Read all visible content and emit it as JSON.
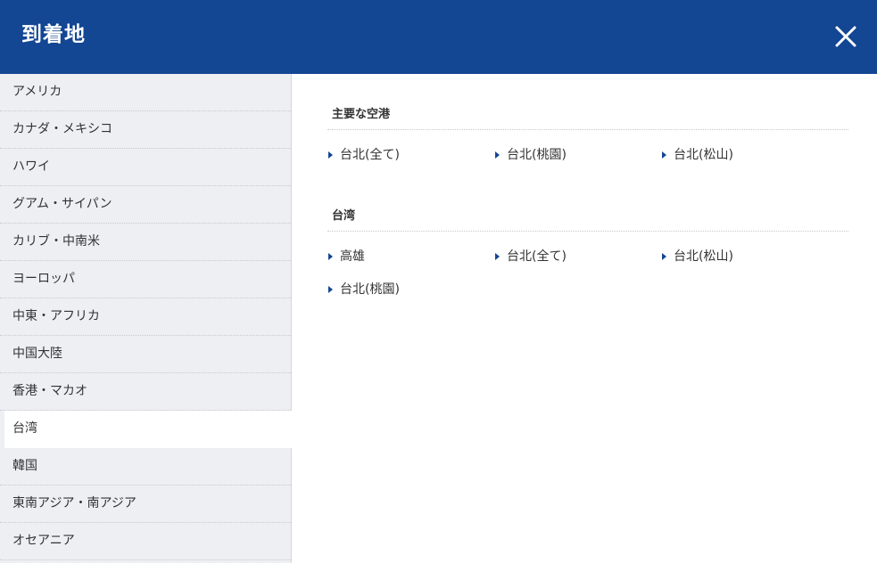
{
  "header": {
    "title": "到着地",
    "close_icon": "close-icon"
  },
  "colors": {
    "header_bg": "#134693",
    "sidebar_bg": "#eeeff3",
    "accent": "#134693"
  },
  "sidebar": {
    "items": [
      {
        "label": "アメリカ",
        "active": false
      },
      {
        "label": "カナダ・メキシコ",
        "active": false
      },
      {
        "label": "ハワイ",
        "active": false
      },
      {
        "label": "グアム・サイパン",
        "active": false
      },
      {
        "label": "カリブ・中南米",
        "active": false
      },
      {
        "label": "ヨーロッパ",
        "active": false
      },
      {
        "label": "中東・アフリカ",
        "active": false
      },
      {
        "label": "中国大陸",
        "active": false
      },
      {
        "label": "香港・マカオ",
        "active": false
      },
      {
        "label": "台湾",
        "active": true
      },
      {
        "label": "韓国",
        "active": false
      },
      {
        "label": "東南アジア・南アジア",
        "active": false
      },
      {
        "label": "オセアニア",
        "active": false
      }
    ]
  },
  "main": {
    "sections": [
      {
        "title": "主要な空港",
        "links": [
          "台北(全て)",
          "台北(桃園)",
          "台北(松山)"
        ]
      },
      {
        "title": "台湾",
        "links": [
          "高雄",
          "台北(全て)",
          "台北(松山)",
          "台北(桃園)"
        ]
      }
    ]
  }
}
